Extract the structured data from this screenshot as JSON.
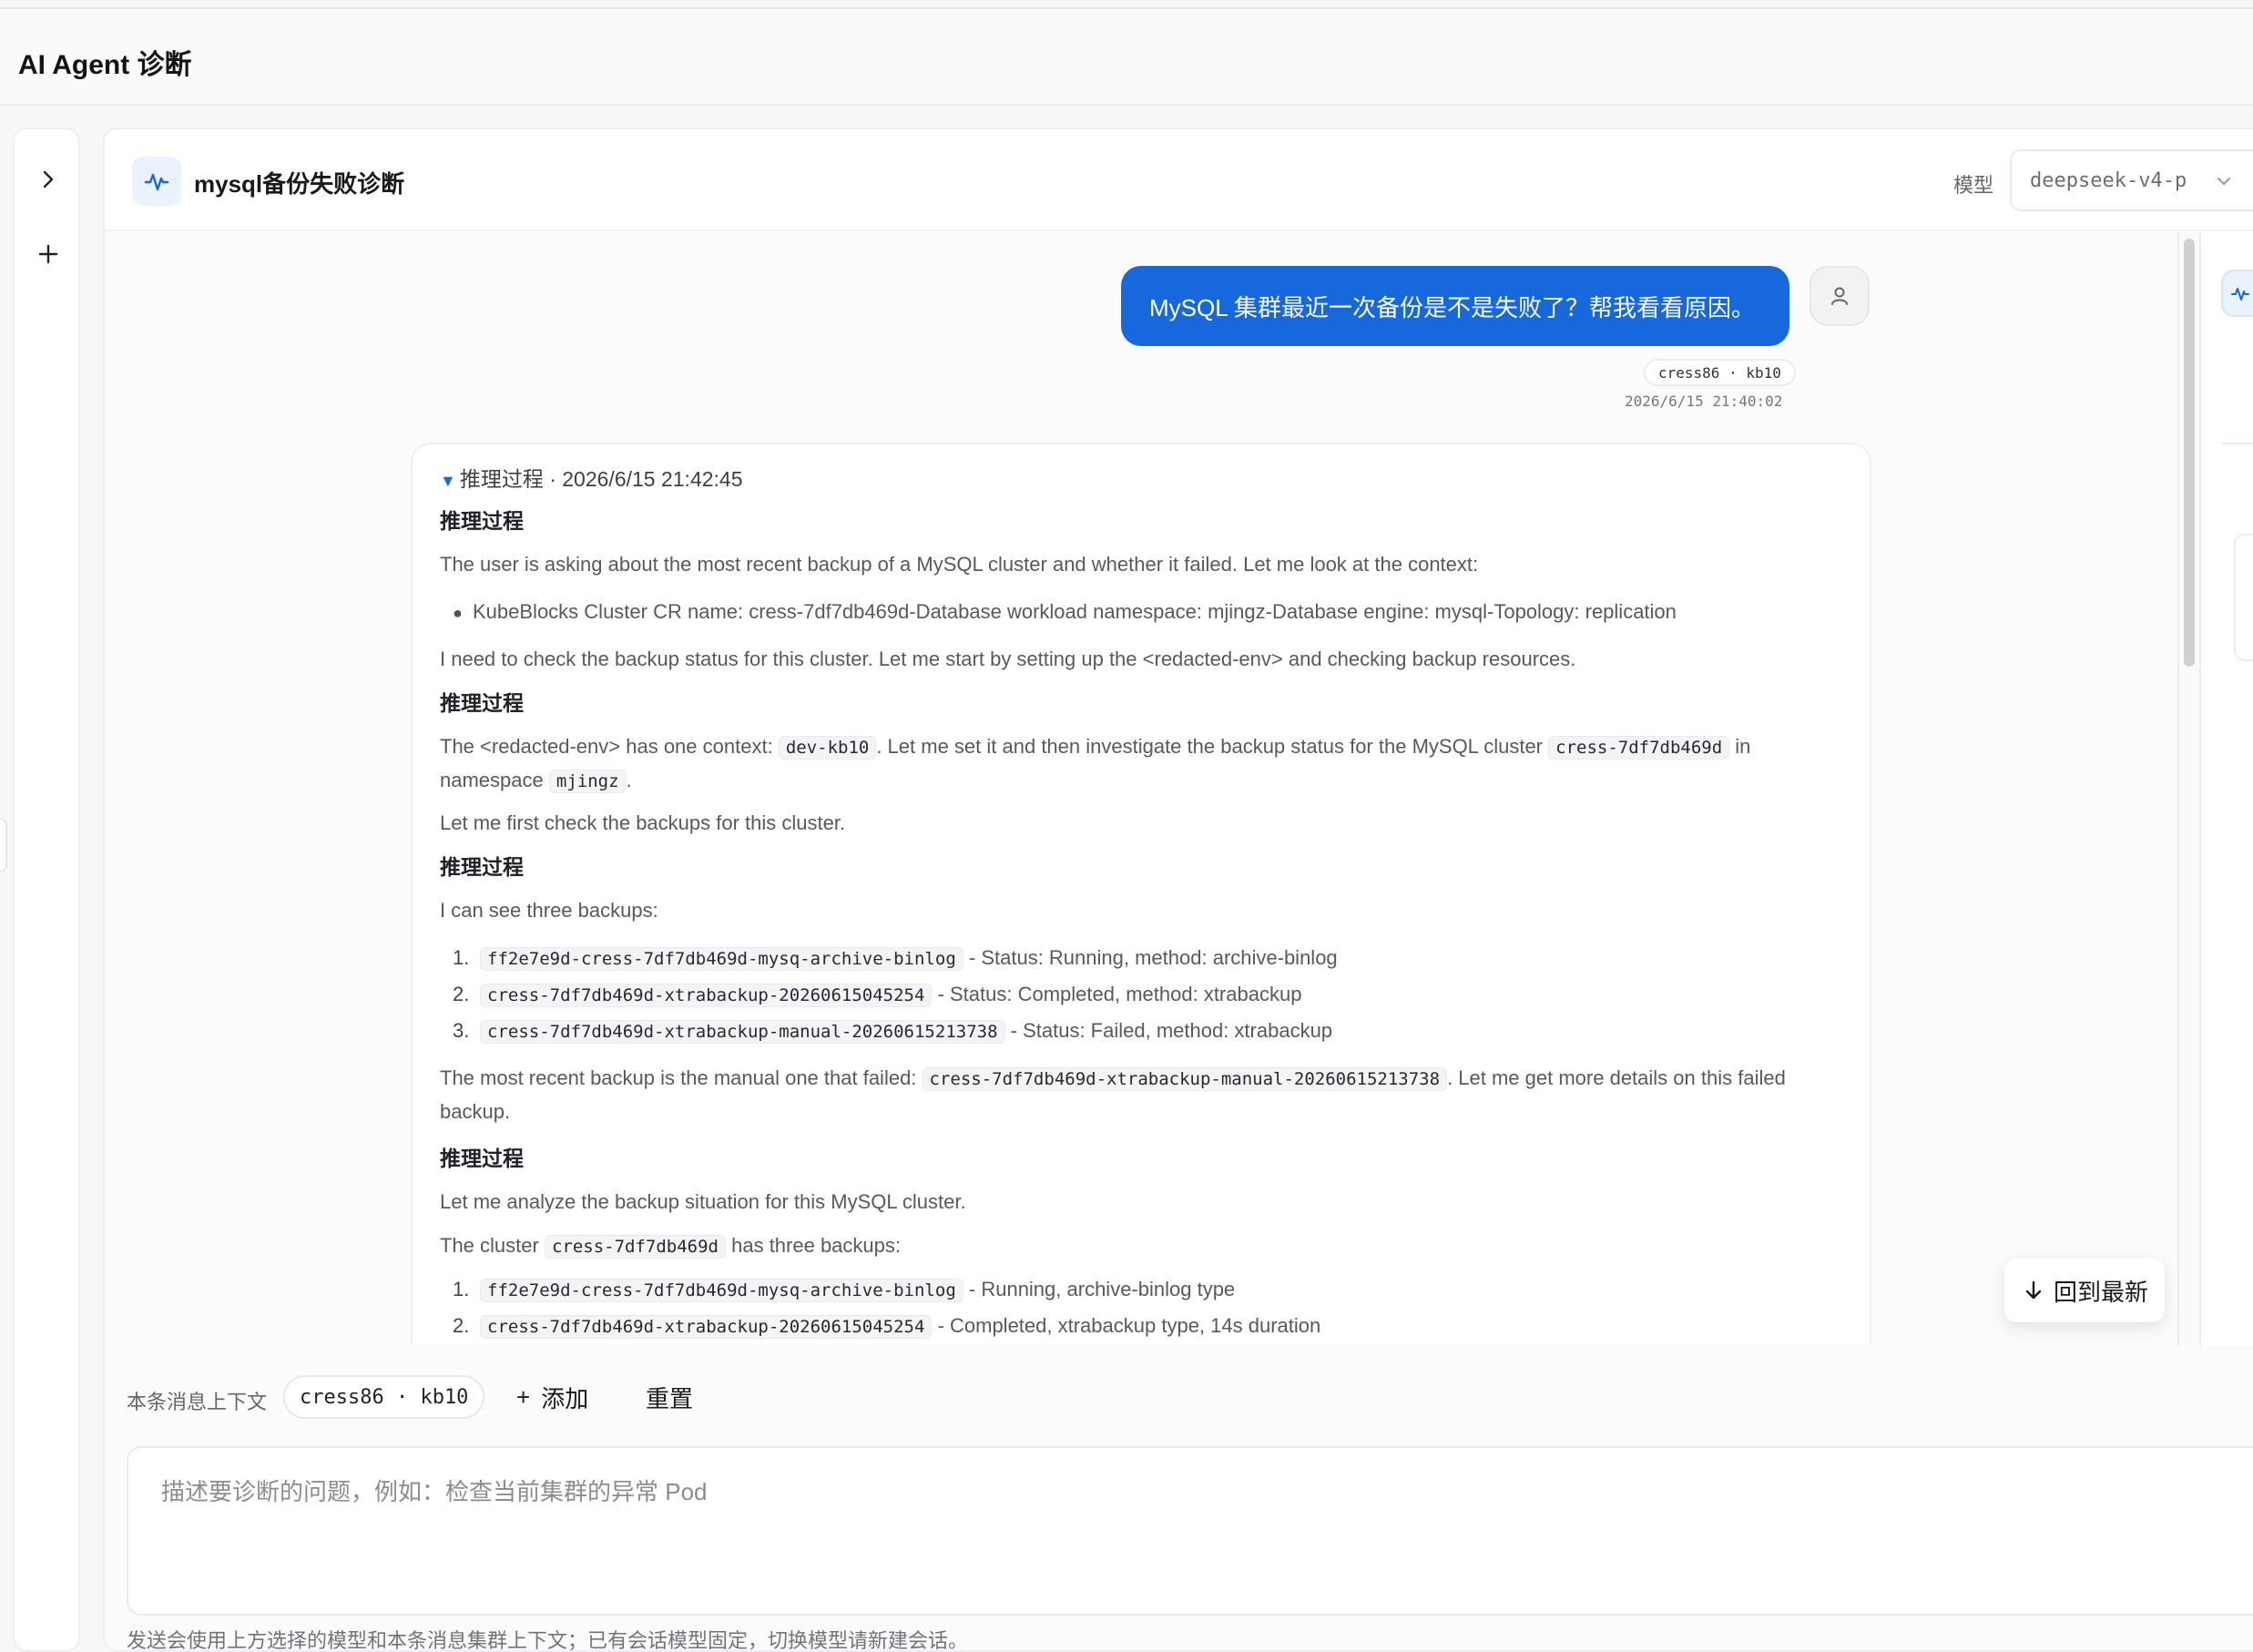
{
  "app": {
    "title": "AI Agent 诊断"
  },
  "session": {
    "title": "mysql备份失败诊断",
    "model_label": "模型",
    "model_value": "deepseek-v4-p"
  },
  "user_message": {
    "text": "MySQL 集群最近一次备份是不是失败了？帮我看看原因。",
    "context_chip": "cress86 · kb10",
    "time": "2026/6/15 21:40:02"
  },
  "reasoning": {
    "summary_label": "推理过程 · 2026/6/15 21:42:45",
    "section_heading": "推理过程",
    "p1": "The user is asking about the most recent backup of a MySQL cluster and whether it failed. Let me look at the context:",
    "bullet1": "KubeBlocks Cluster CR name: cress-7df7db469d-Database workload namespace: mjingz-Database engine: mysql-Topology: replication",
    "p2": "I need to check the backup status for this cluster. Let me start by setting up the <redacted-env> and checking backup resources.",
    "p3_a": "The <redacted-env> has one context:",
    "p3_code1": "dev-kb10",
    "p3_b": ". Let me set it and then investigate the backup status for the MySQL cluster",
    "p3_code2": "cress-7df7db469d",
    "p3_c": "in",
    "p3_d": "namespace",
    "p3_code3": "mjingz",
    "p3_e": ".",
    "p4": "Let me first check the backups for this cluster.",
    "p5": "I can see three backups:",
    "list1": [
      {
        "num": "1.",
        "code": "ff2e7e9d-cress-7df7db469d-mysq-archive-binlog",
        "text": "- Status: Running, method: archive-binlog"
      },
      {
        "num": "2.",
        "code": "cress-7df7db469d-xtrabackup-20260615045254",
        "text": "- Status: Completed, method: xtrabackup"
      },
      {
        "num": "3.",
        "code": "cress-7df7db469d-xtrabackup-manual-20260615213738",
        "text": "- Status: Failed, method: xtrabackup"
      }
    ],
    "p6_a": "The most recent backup is the manual one that failed:",
    "p6_code": "cress-7df7db469d-xtrabackup-manual-20260615213738",
    "p6_b": ". Let me get more details on this failed",
    "p6_c": "backup.",
    "p7": "Let me analyze the backup situation for this MySQL cluster.",
    "p8_a": "The cluster",
    "p8_code": "cress-7df7db469d",
    "p8_b": "has three backups:",
    "list2": [
      {
        "num": "1.",
        "code": "ff2e7e9d-cress-7df7db469d-mysq-archive-binlog",
        "text": "- Running, archive-binlog type"
      },
      {
        "num": "2.",
        "code": "cress-7df7db469d-xtrabackup-20260615045254",
        "text": "- Completed, xtrabackup type, 14s duration"
      }
    ]
  },
  "back_to_latest": "回到最新",
  "composer": {
    "context_label": "本条消息上下文",
    "context_chip": "cress86 · kb10",
    "add_label": "添加",
    "reset_label": "重置",
    "placeholder": "描述要诊断的问题，例如：检查当前集群的异常 Pod",
    "footnote": "发送会使用上方选择的模型和本条消息集群上下文；已有会话模型固定，切换模型请新建会话。"
  },
  "colors": {
    "accent": "#1668dc",
    "background": "#f7f7f8"
  }
}
